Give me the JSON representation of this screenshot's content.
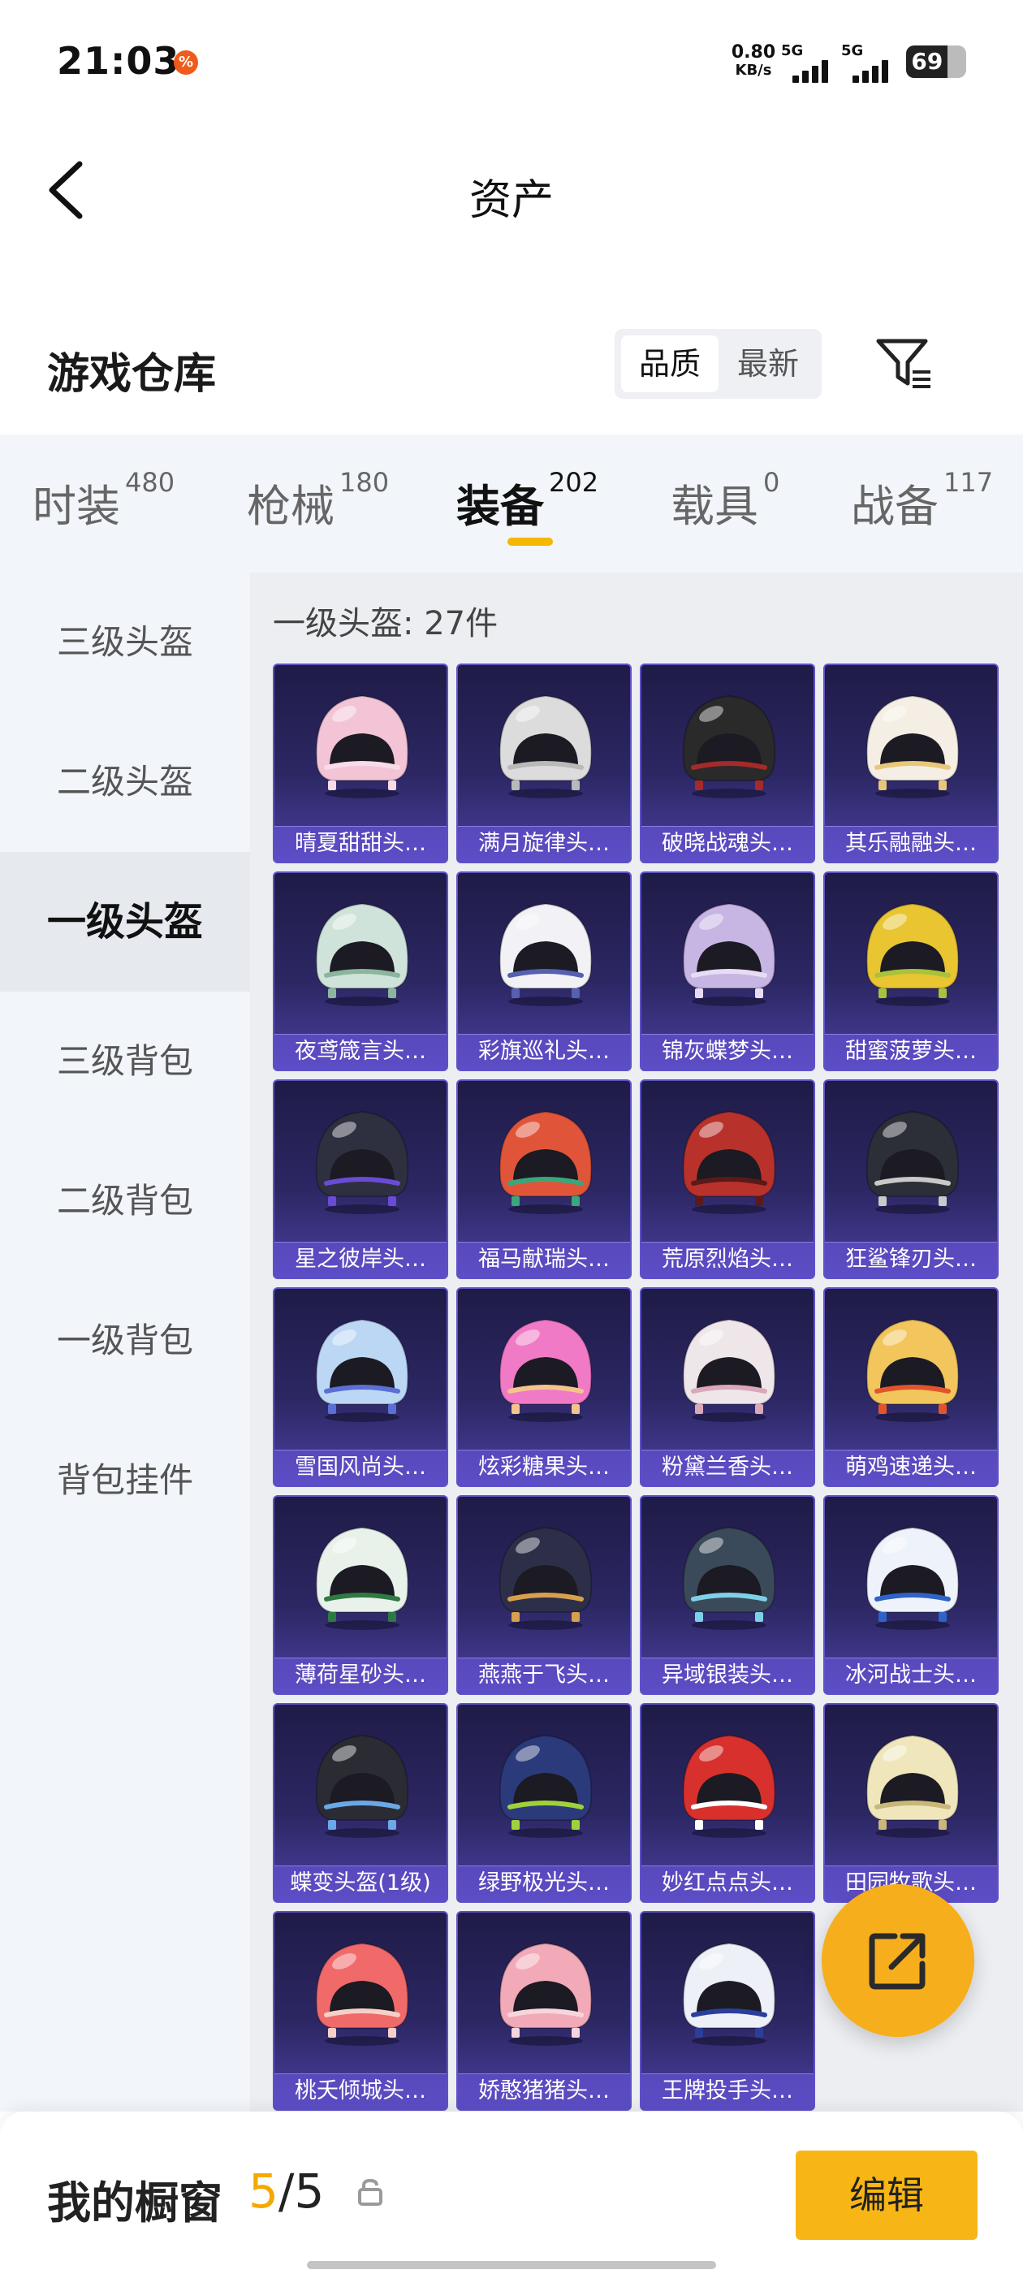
{
  "status_bar": {
    "time": "21:03",
    "notification_badge": "%",
    "net_speed_value": "0.80",
    "net_speed_unit": "KB/s",
    "signal_1_label": "5G",
    "signal_2_label": "5G",
    "battery_level": "69"
  },
  "nav": {
    "title": "资产",
    "back_icon": "chevron-left-icon"
  },
  "storage": {
    "title": "游戏仓库",
    "sort_options": [
      "品质",
      "最新"
    ],
    "sort_selected": "品质",
    "filter_icon": "filter-icon"
  },
  "tabs": [
    {
      "label": "时装",
      "count": "480"
    },
    {
      "label": "枪械",
      "count": "180"
    },
    {
      "label": "装备",
      "count": "202",
      "active": true
    },
    {
      "label": "载具",
      "count": "0"
    },
    {
      "label": "战备",
      "count": "117"
    }
  ],
  "sidebar": {
    "items": [
      "三级头盔",
      "二级头盔",
      "一级头盔",
      "三级背包",
      "二级背包",
      "一级背包",
      "背包挂件"
    ],
    "active_index": 2
  },
  "content": {
    "count_label": "一级头盔: 27件",
    "items": [
      {
        "name": "晴夏甜甜头…",
        "color": "#f3c4d6",
        "trim": "#f7dbe6"
      },
      {
        "name": "满月旋律头…",
        "color": "#dcdcdc",
        "trim": "#b9b9b9"
      },
      {
        "name": "破晓战魂头…",
        "color": "#2a2a2a",
        "trim": "#a52a2a"
      },
      {
        "name": "其乐融融头…",
        "color": "#f4eee4",
        "trim": "#e8c77a"
      },
      {
        "name": "夜鸢箴言头…",
        "color": "#cfe3da",
        "trim": "#8bb59f"
      },
      {
        "name": "彩旗巡礼头…",
        "color": "#f1f1f6",
        "trim": "#5560b0"
      },
      {
        "name": "锦灰蝶梦头…",
        "color": "#c7b5e4",
        "trim": "#e8dcf5"
      },
      {
        "name": "甜蜜菠萝头…",
        "color": "#e8c531",
        "trim": "#a8c23c"
      },
      {
        "name": "星之彼岸头…",
        "color": "#2e3040",
        "trim": "#6a4bd6"
      },
      {
        "name": "福马献瑞头…",
        "color": "#e0553a",
        "trim": "#3aa67b"
      },
      {
        "name": "荒原烈焰头…",
        "color": "#b8322b",
        "trim": "#5a1a1a"
      },
      {
        "name": "狂鲨锋刃头…",
        "color": "#2c2f38",
        "trim": "#c9c9c9"
      },
      {
        "name": "雪国风尚头…",
        "color": "#bcd7f4",
        "trim": "#5b6fd6"
      },
      {
        "name": "炫彩糖果头…",
        "color": "#f07ac6",
        "trim": "#f4c48c"
      },
      {
        "name": "粉黛兰香头…",
        "color": "#efe6ea",
        "trim": "#d9a8b9"
      },
      {
        "name": "萌鸡速递头…",
        "color": "#f2c65c",
        "trim": "#e2552c"
      },
      {
        "name": "薄荷星砂头…",
        "color": "#e8f2ea",
        "trim": "#2f7a43"
      },
      {
        "name": "燕燕于飞头…",
        "color": "#2d2f48",
        "trim": "#d7a04d"
      },
      {
        "name": "异域银装头…",
        "color": "#3a4a5a",
        "trim": "#7ed0e6"
      },
      {
        "name": "冰河战士头…",
        "color": "#eef2fa",
        "trim": "#2f63c5"
      },
      {
        "name": "蝶变头盔(1级)",
        "color": "#2b2c33",
        "trim": "#6aa8e8"
      },
      {
        "name": "绿野极光头…",
        "color": "#2b3a7a",
        "trim": "#9fd23a"
      },
      {
        "name": "妙红点点头…",
        "color": "#d8302d",
        "trim": "#ffffff"
      },
      {
        "name": "田园牧歌头…",
        "color": "#efe6bc",
        "trim": "#c9b77a"
      },
      {
        "name": "桃夭倾城头…",
        "color": "#f06a6a",
        "trim": "#f6d0c8"
      },
      {
        "name": "娇憨猪猪头…",
        "color": "#f2aab8",
        "trim": "#f6d5dc"
      },
      {
        "name": "王牌投手头…",
        "color": "#eef0f8",
        "trim": "#2b3f9a"
      }
    ]
  },
  "share_button": {
    "icon": "share-icon"
  },
  "bottom_bar": {
    "label": "我的橱窗",
    "current": "5",
    "separator": "/",
    "total": "5",
    "lock_icon": "lock-icon",
    "edit_label": "编辑"
  },
  "colors": {
    "accent": "#f8b616",
    "card_border": "#5d52c8",
    "card_bg": "#2c2763"
  }
}
